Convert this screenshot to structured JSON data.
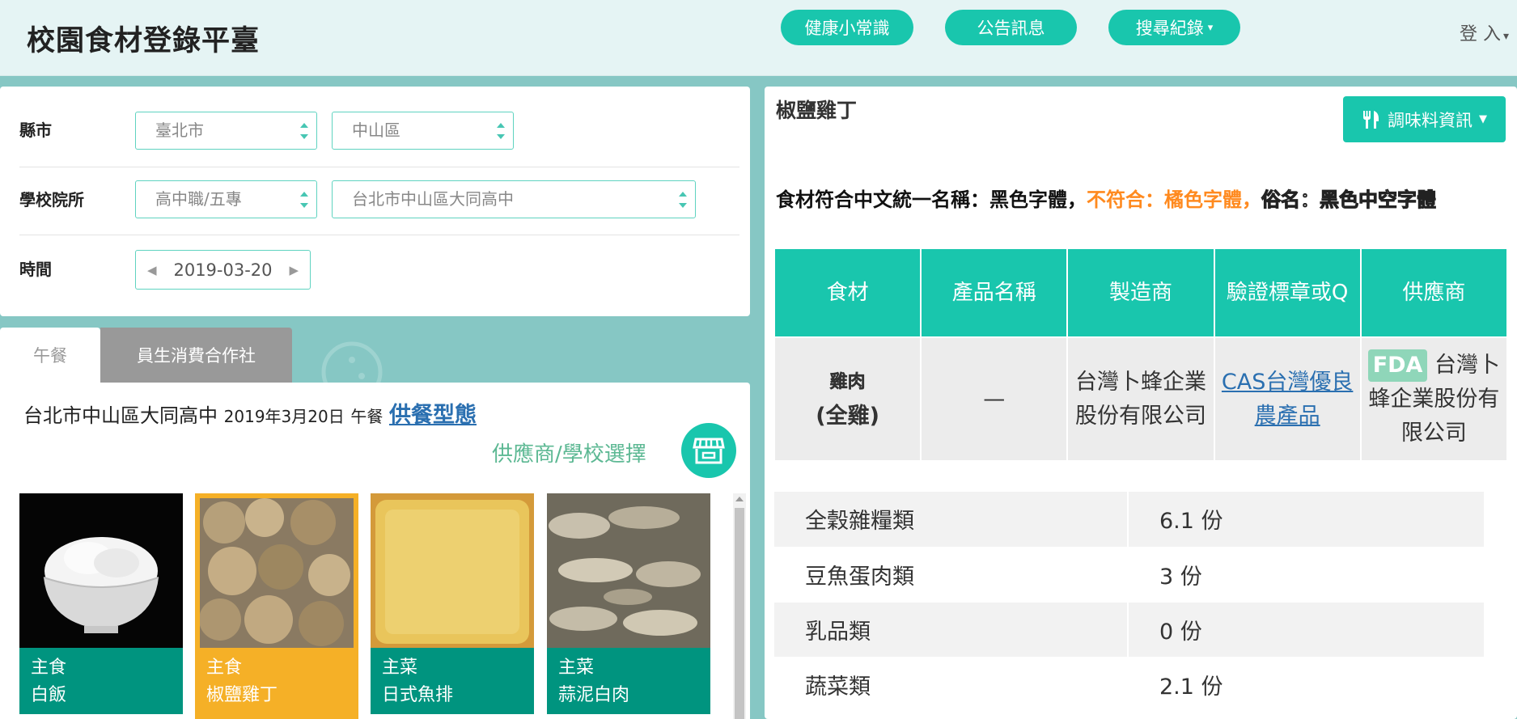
{
  "header": {
    "title": "校園食材登錄平臺",
    "nav": [
      {
        "label": "健康小常識"
      },
      {
        "label": "公告訊息"
      },
      {
        "label": "搜尋紀錄",
        "caret": "▾"
      }
    ],
    "login": "登 入",
    "login_caret": "▾"
  },
  "filters": {
    "city_label": "縣市",
    "city_value": "臺北市",
    "district_value": "中山區",
    "school_label": "學校院所",
    "school_type_value": "高中職/五專",
    "school_value": "台北市中山區大同高中",
    "time_label": "時間",
    "date_value": "2019-03-20",
    "prev": "◀",
    "next": "▶"
  },
  "tabs": [
    {
      "label": "午餐",
      "active": true
    },
    {
      "label": "員生消費合作社",
      "active": false
    }
  ],
  "menu": {
    "school": "台北市中山區大同高中",
    "date": "2019年3月20日",
    "meal": "午餐",
    "supply_link": "供餐型態",
    "supplier_select": "供應商/學校選擇",
    "shop_icon": "storefront-icon",
    "items": [
      {
        "category": "主食",
        "name": "白飯",
        "selected": false
      },
      {
        "category": "主食",
        "name": "椒鹽雞丁",
        "selected": true
      },
      {
        "category": "主菜",
        "name": "日式魚排",
        "selected": false
      },
      {
        "category": "主菜",
        "name": "蒜泥白肉",
        "selected": false
      }
    ]
  },
  "detail": {
    "dish_name": "椒鹽雞丁",
    "seasoning_button": "調味料資訊",
    "seasoning_icon": "utensils-icon",
    "notice": {
      "part1": "食材符合中文統一名稱：黑色字體，",
      "part2": "不符合：橘色字體，",
      "part3": "俗名：黑色中空字體"
    },
    "table_headers": [
      "食材",
      "產品名稱",
      "製造商",
      "驗證標章或Q",
      "供應商"
    ],
    "ingredient": {
      "name": "雞肉",
      "sub": "(全雞)",
      "product": "—",
      "manufacturer": "台灣卜蜂企業股份有限公司",
      "certification": "CAS台灣優良農產品",
      "fda": "FDA",
      "supplier": "台灣卜蜂企業股份有限公司"
    },
    "nutrition": [
      {
        "label": "全穀雜糧類",
        "value": "6.1 份"
      },
      {
        "label": "豆魚蛋肉類",
        "value": "3 份"
      },
      {
        "label": "乳品類",
        "value": "0 份"
      },
      {
        "label": "蔬菜類",
        "value": "2.1 份"
      }
    ]
  },
  "colors": {
    "accent": "#19c6ad",
    "caption_green": "#00947f",
    "selected_orange": "#f5b027",
    "orange_text": "#ff8a1f",
    "link_blue": "#2a6fb0",
    "background_teal": "#86c7c4"
  }
}
